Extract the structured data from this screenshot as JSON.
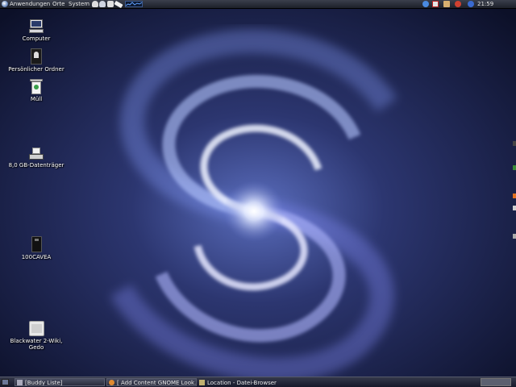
{
  "top_panel": {
    "menus": [
      "Anwendungen",
      "Orte",
      "System"
    ],
    "clock": "21:59",
    "tray_icons": [
      "network-icon",
      "mail-icon",
      "volume-icon",
      "bluetooth-icon",
      "power-icon"
    ]
  },
  "desktop": {
    "icons": [
      {
        "name": "computer",
        "label": "Computer"
      },
      {
        "name": "personal-folder",
        "label": "Persönlicher Ordner"
      },
      {
        "name": "trash",
        "label": "Müll"
      },
      {
        "name": "drive-1",
        "label": "8,0 GB-Datenträger"
      },
      {
        "name": "drive-2",
        "label": "100CAVEA"
      },
      {
        "name": "drive-3",
        "label": "Blackwater 2-Wiki, Gedo"
      }
    ]
  },
  "taskbar": {
    "tasks": [
      "[Buddy Liste]",
      "[ Add Content GNOME Look...",
      "Location - Datei-Browser"
    ]
  },
  "colors": {
    "panel": "#2a2d3a",
    "wallpaper_base": "#141b3a",
    "swirl": "#aac0ff"
  }
}
